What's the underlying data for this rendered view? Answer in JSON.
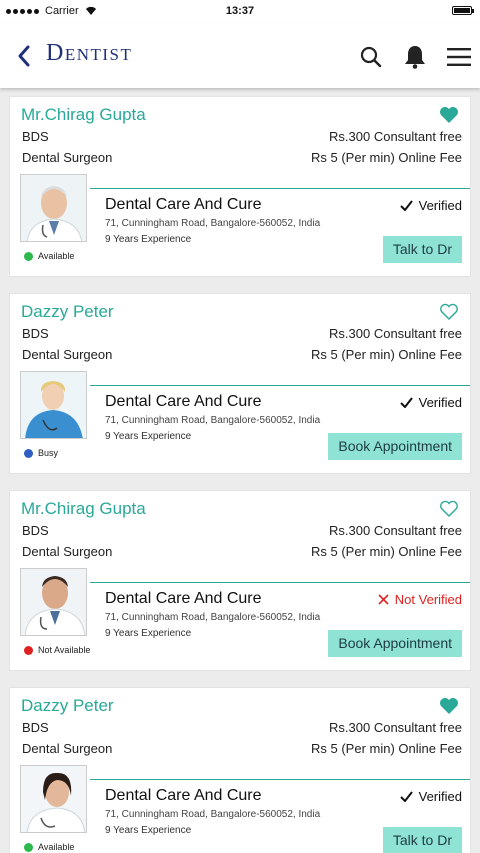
{
  "status_bar": {
    "carrier": "Carrier",
    "time": "13:37"
  },
  "header": {
    "title": "Dentist"
  },
  "doctors": [
    {
      "name": "Mr.Chirag Gupta",
      "favorite": true,
      "degree": "BDS",
      "specialty": "Dental Surgeon",
      "fee_consult": "Rs.300 Consultant free",
      "fee_online": "Rs 5 (Per min) Online Fee",
      "clinic": "Dental Care And Cure",
      "address": "71, Cunningham Road, Bangalore-560052, India",
      "experience": "9 Years Experience",
      "verification": "Verified",
      "verified": true,
      "availability": "Available",
      "availability_color": "#2cb84a",
      "action": "Talk to Dr"
    },
    {
      "name": "Dazzy Peter",
      "favorite": false,
      "degree": "BDS",
      "specialty": "Dental Surgeon",
      "fee_consult": "Rs.300 Consultant free",
      "fee_online": "Rs 5 (Per min) Online Fee",
      "clinic": "Dental Care And Cure",
      "address": "71, Cunningham Road, Bangalore-560052, India",
      "experience": "9 Years Experience",
      "verification": "Verified",
      "verified": true,
      "availability": "Busy",
      "availability_color": "#2f5fc4",
      "action": "Book Appointment"
    },
    {
      "name": "Mr.Chirag Gupta",
      "favorite": false,
      "degree": "BDS",
      "specialty": "Dental Surgeon",
      "fee_consult": "Rs.300 Consultant free",
      "fee_online": "Rs 5 (Per min) Online Fee",
      "clinic": "Dental Care And Cure",
      "address": "71, Cunningham Road, Bangalore-560052, India",
      "experience": "9 Years Experience",
      "verification": "Not Verified",
      "verified": false,
      "availability": "Not Available",
      "availability_color": "#e02020",
      "action": "Book Appointment"
    },
    {
      "name": "Dazzy Peter",
      "favorite": true,
      "degree": "BDS",
      "specialty": "Dental Surgeon",
      "fee_consult": "Rs.300 Consultant free",
      "fee_online": "Rs 5 (Per min) Online Fee",
      "clinic": "Dental Care And Cure",
      "address": "71, Cunningham Road, Bangalore-560052, India",
      "experience": "9 Years Experience",
      "verification": "Verified",
      "verified": true,
      "availability": "Available",
      "availability_color": "#2cb84a",
      "action": "Talk to Dr"
    }
  ],
  "colors": {
    "accent": "#2aa898",
    "button": "#8fe3d4",
    "title": "#1f2f7a",
    "error": "#e02020"
  },
  "icons": {
    "back": "chevron-left-icon",
    "search": "search-icon",
    "bell": "bell-icon",
    "menu": "hamburger-menu-icon",
    "favorite": "heart-icon",
    "verified": "checkmark-icon",
    "not_verified": "cross-icon"
  }
}
